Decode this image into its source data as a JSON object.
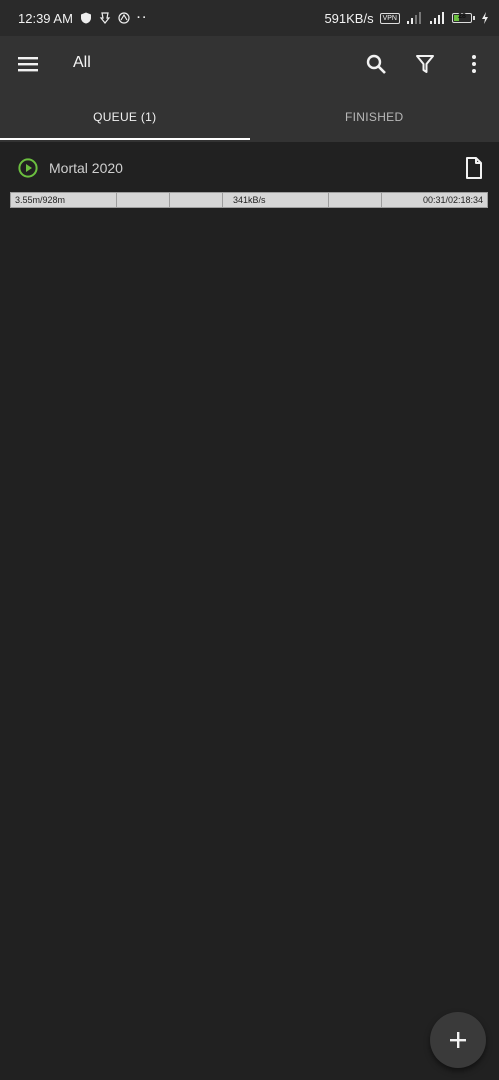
{
  "status_bar": {
    "time": "12:39 AM",
    "net_speed": "591KB/s",
    "vpn": "VPN",
    "battery": "28"
  },
  "toolbar": {
    "title": "All",
    "icons": [
      "menu-icon",
      "search-icon",
      "filter-icon",
      "more-vert-icon"
    ]
  },
  "tabs": [
    {
      "label": "QUEUE (1)",
      "active": true
    },
    {
      "label": "FINISHED",
      "active": false
    }
  ],
  "queue": [
    {
      "title": "Mortal 2020",
      "status_icon": "play-circle-icon",
      "progress_downloaded": "3.55m/928m",
      "progress_speed": "341kB/s",
      "progress_time": "00:31/02:18:34",
      "progress_fraction": 0.004
    }
  ],
  "fab": {
    "icon": "add-icon"
  },
  "colors": {
    "background": "#212121",
    "toolbar": "#333333",
    "accent_green": "#6bbf3f"
  }
}
